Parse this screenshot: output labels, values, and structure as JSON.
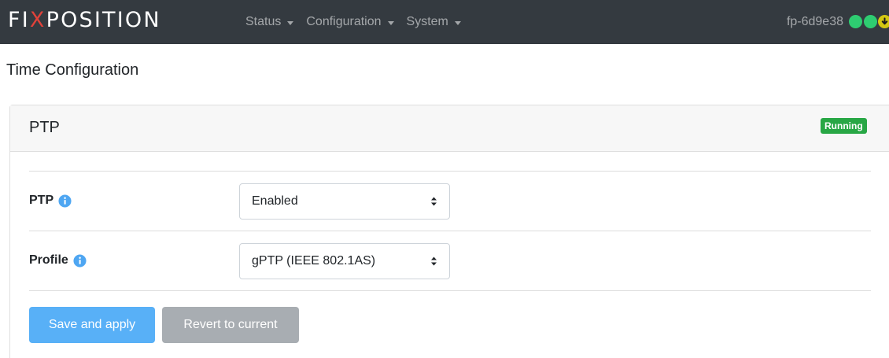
{
  "navbar": {
    "brand_pre": "FI",
    "brand_x": "X",
    "brand_post": "POSITION",
    "menu": [
      {
        "label": "Status"
      },
      {
        "label": "Configuration"
      },
      {
        "label": "System"
      }
    ],
    "hostname": "fp-6d9e38",
    "status_colors": [
      "#2ecc71",
      "#2ecc71",
      "#d4c712"
    ]
  },
  "page": {
    "title": "Time Configuration"
  },
  "card": {
    "title": "PTP",
    "badge": "Running",
    "badge_color": "#28a745",
    "fields": [
      {
        "label": "PTP",
        "value": "Enabled",
        "icon": "info-icon"
      },
      {
        "label": "Profile",
        "value": "gPTP (IEEE 802.1AS)",
        "icon": "info-icon"
      }
    ],
    "buttons": {
      "save": "Save and apply",
      "revert": "Revert to current"
    }
  }
}
